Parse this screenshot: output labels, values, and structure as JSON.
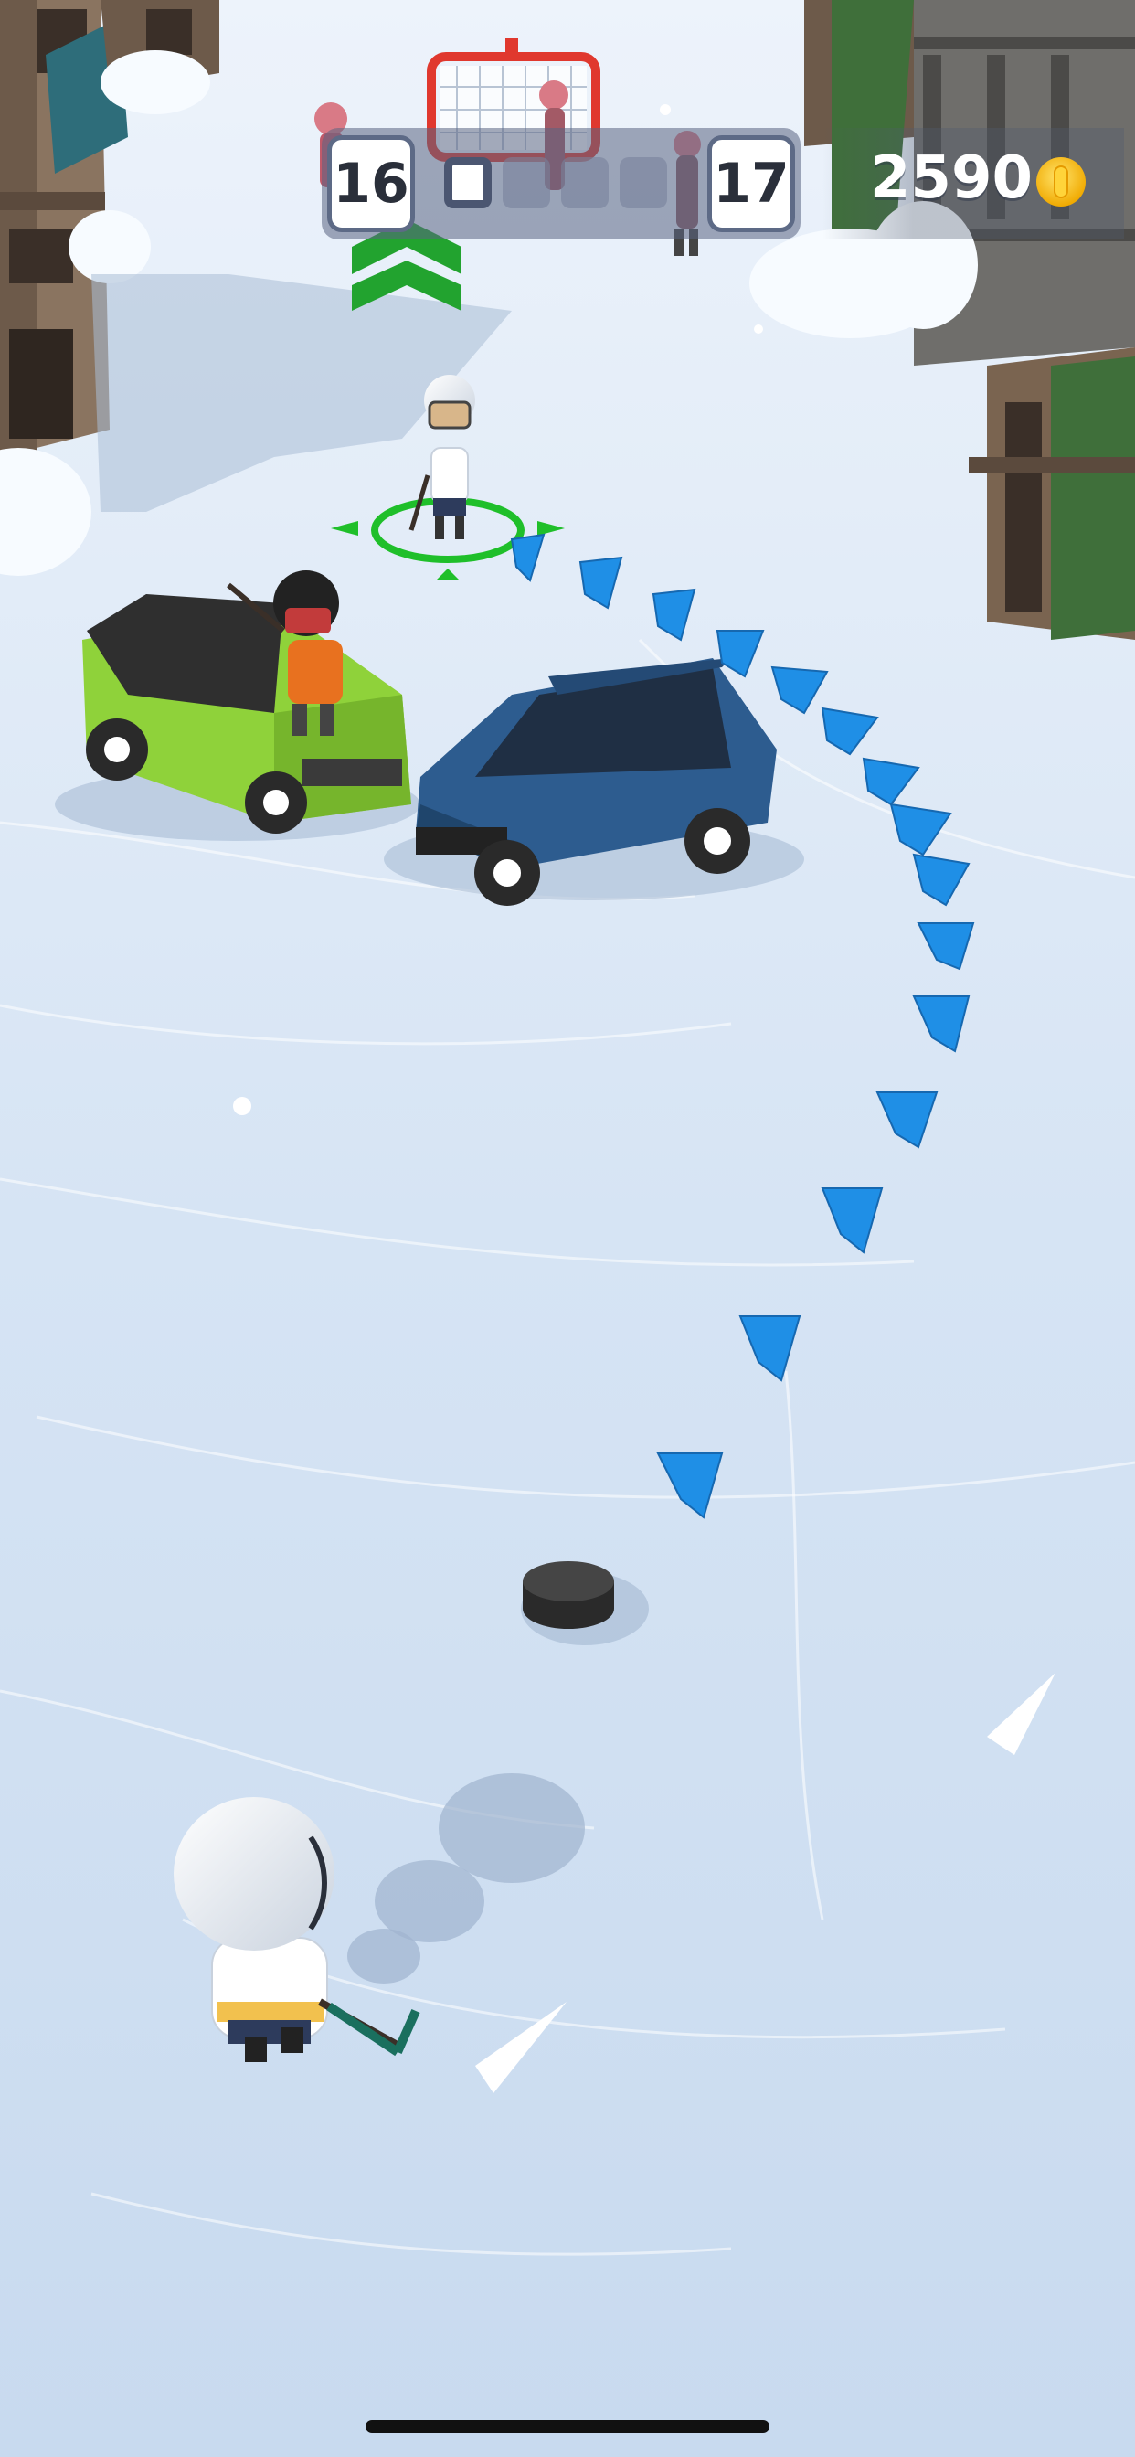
{
  "hud": {
    "level_current": "16",
    "level_next": "17",
    "stage_progress": {
      "completed": 1,
      "total": 4
    },
    "coin_count": "2590"
  },
  "icons": {
    "coin": "coin-icon",
    "aim_arrow": "chevron-icon",
    "target_marker": "target-ring-icon",
    "objective_marker": "down-arrow-icon"
  },
  "colors": {
    "ice": "#dbe7f5",
    "aim_arrow": "#1f8fe6",
    "target_ring": "#1fbf2a",
    "green_car": "#8fd23a",
    "blue_car": "#2d5c8f",
    "coin": "#f6c21b",
    "hud_panel": "#5d6a86"
  }
}
